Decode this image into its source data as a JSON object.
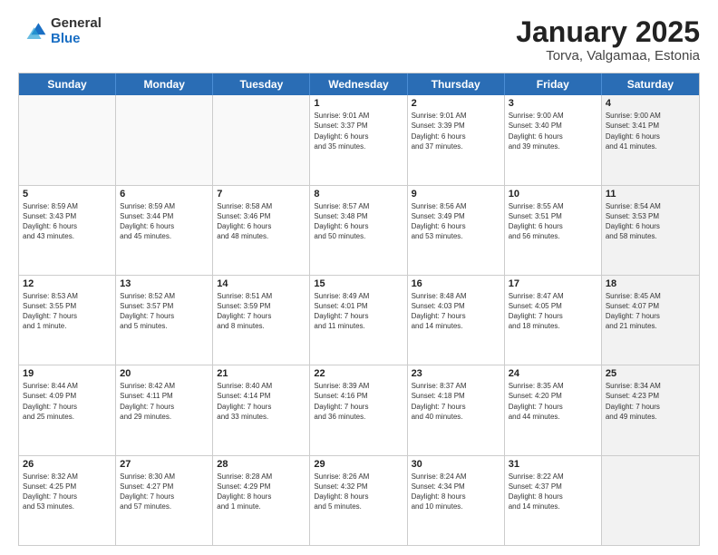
{
  "logo": {
    "general": "General",
    "blue": "Blue"
  },
  "title": {
    "month": "January 2025",
    "location": "Torva, Valgamaa, Estonia"
  },
  "weekdays": [
    "Sunday",
    "Monday",
    "Tuesday",
    "Wednesday",
    "Thursday",
    "Friday",
    "Saturday"
  ],
  "rows": [
    {
      "cells": [
        {
          "empty": true,
          "shaded": false
        },
        {
          "empty": true,
          "shaded": false
        },
        {
          "empty": true,
          "shaded": false
        },
        {
          "day": "1",
          "lines": [
            "Sunrise: 9:01 AM",
            "Sunset: 3:37 PM",
            "Daylight: 6 hours",
            "and 35 minutes."
          ]
        },
        {
          "day": "2",
          "lines": [
            "Sunrise: 9:01 AM",
            "Sunset: 3:39 PM",
            "Daylight: 6 hours",
            "and 37 minutes."
          ]
        },
        {
          "day": "3",
          "lines": [
            "Sunrise: 9:00 AM",
            "Sunset: 3:40 PM",
            "Daylight: 6 hours",
            "and 39 minutes."
          ]
        },
        {
          "day": "4",
          "lines": [
            "Sunrise: 9:00 AM",
            "Sunset: 3:41 PM",
            "Daylight: 6 hours",
            "and 41 minutes."
          ],
          "shaded": true
        }
      ]
    },
    {
      "cells": [
        {
          "day": "5",
          "lines": [
            "Sunrise: 8:59 AM",
            "Sunset: 3:43 PM",
            "Daylight: 6 hours",
            "and 43 minutes."
          ],
          "shaded": false
        },
        {
          "day": "6",
          "lines": [
            "Sunrise: 8:59 AM",
            "Sunset: 3:44 PM",
            "Daylight: 6 hours",
            "and 45 minutes."
          ]
        },
        {
          "day": "7",
          "lines": [
            "Sunrise: 8:58 AM",
            "Sunset: 3:46 PM",
            "Daylight: 6 hours",
            "and 48 minutes."
          ]
        },
        {
          "day": "8",
          "lines": [
            "Sunrise: 8:57 AM",
            "Sunset: 3:48 PM",
            "Daylight: 6 hours",
            "and 50 minutes."
          ]
        },
        {
          "day": "9",
          "lines": [
            "Sunrise: 8:56 AM",
            "Sunset: 3:49 PM",
            "Daylight: 6 hours",
            "and 53 minutes."
          ]
        },
        {
          "day": "10",
          "lines": [
            "Sunrise: 8:55 AM",
            "Sunset: 3:51 PM",
            "Daylight: 6 hours",
            "and 56 minutes."
          ]
        },
        {
          "day": "11",
          "lines": [
            "Sunrise: 8:54 AM",
            "Sunset: 3:53 PM",
            "Daylight: 6 hours",
            "and 58 minutes."
          ],
          "shaded": true
        }
      ]
    },
    {
      "cells": [
        {
          "day": "12",
          "lines": [
            "Sunrise: 8:53 AM",
            "Sunset: 3:55 PM",
            "Daylight: 7 hours",
            "and 1 minute."
          ],
          "shaded": false
        },
        {
          "day": "13",
          "lines": [
            "Sunrise: 8:52 AM",
            "Sunset: 3:57 PM",
            "Daylight: 7 hours",
            "and 5 minutes."
          ]
        },
        {
          "day": "14",
          "lines": [
            "Sunrise: 8:51 AM",
            "Sunset: 3:59 PM",
            "Daylight: 7 hours",
            "and 8 minutes."
          ]
        },
        {
          "day": "15",
          "lines": [
            "Sunrise: 8:49 AM",
            "Sunset: 4:01 PM",
            "Daylight: 7 hours",
            "and 11 minutes."
          ]
        },
        {
          "day": "16",
          "lines": [
            "Sunrise: 8:48 AM",
            "Sunset: 4:03 PM",
            "Daylight: 7 hours",
            "and 14 minutes."
          ]
        },
        {
          "day": "17",
          "lines": [
            "Sunrise: 8:47 AM",
            "Sunset: 4:05 PM",
            "Daylight: 7 hours",
            "and 18 minutes."
          ]
        },
        {
          "day": "18",
          "lines": [
            "Sunrise: 8:45 AM",
            "Sunset: 4:07 PM",
            "Daylight: 7 hours",
            "and 21 minutes."
          ],
          "shaded": true
        }
      ]
    },
    {
      "cells": [
        {
          "day": "19",
          "lines": [
            "Sunrise: 8:44 AM",
            "Sunset: 4:09 PM",
            "Daylight: 7 hours",
            "and 25 minutes."
          ],
          "shaded": false
        },
        {
          "day": "20",
          "lines": [
            "Sunrise: 8:42 AM",
            "Sunset: 4:11 PM",
            "Daylight: 7 hours",
            "and 29 minutes."
          ]
        },
        {
          "day": "21",
          "lines": [
            "Sunrise: 8:40 AM",
            "Sunset: 4:14 PM",
            "Daylight: 7 hours",
            "and 33 minutes."
          ]
        },
        {
          "day": "22",
          "lines": [
            "Sunrise: 8:39 AM",
            "Sunset: 4:16 PM",
            "Daylight: 7 hours",
            "and 36 minutes."
          ]
        },
        {
          "day": "23",
          "lines": [
            "Sunrise: 8:37 AM",
            "Sunset: 4:18 PM",
            "Daylight: 7 hours",
            "and 40 minutes."
          ]
        },
        {
          "day": "24",
          "lines": [
            "Sunrise: 8:35 AM",
            "Sunset: 4:20 PM",
            "Daylight: 7 hours",
            "and 44 minutes."
          ]
        },
        {
          "day": "25",
          "lines": [
            "Sunrise: 8:34 AM",
            "Sunset: 4:23 PM",
            "Daylight: 7 hours",
            "and 49 minutes."
          ],
          "shaded": true
        }
      ]
    },
    {
      "cells": [
        {
          "day": "26",
          "lines": [
            "Sunrise: 8:32 AM",
            "Sunset: 4:25 PM",
            "Daylight: 7 hours",
            "and 53 minutes."
          ],
          "shaded": false
        },
        {
          "day": "27",
          "lines": [
            "Sunrise: 8:30 AM",
            "Sunset: 4:27 PM",
            "Daylight: 7 hours",
            "and 57 minutes."
          ]
        },
        {
          "day": "28",
          "lines": [
            "Sunrise: 8:28 AM",
            "Sunset: 4:29 PM",
            "Daylight: 8 hours",
            "and 1 minute."
          ]
        },
        {
          "day": "29",
          "lines": [
            "Sunrise: 8:26 AM",
            "Sunset: 4:32 PM",
            "Daylight: 8 hours",
            "and 5 minutes."
          ]
        },
        {
          "day": "30",
          "lines": [
            "Sunrise: 8:24 AM",
            "Sunset: 4:34 PM",
            "Daylight: 8 hours",
            "and 10 minutes."
          ]
        },
        {
          "day": "31",
          "lines": [
            "Sunrise: 8:22 AM",
            "Sunset: 4:37 PM",
            "Daylight: 8 hours",
            "and 14 minutes."
          ]
        },
        {
          "empty": true,
          "shaded": true
        }
      ]
    }
  ]
}
